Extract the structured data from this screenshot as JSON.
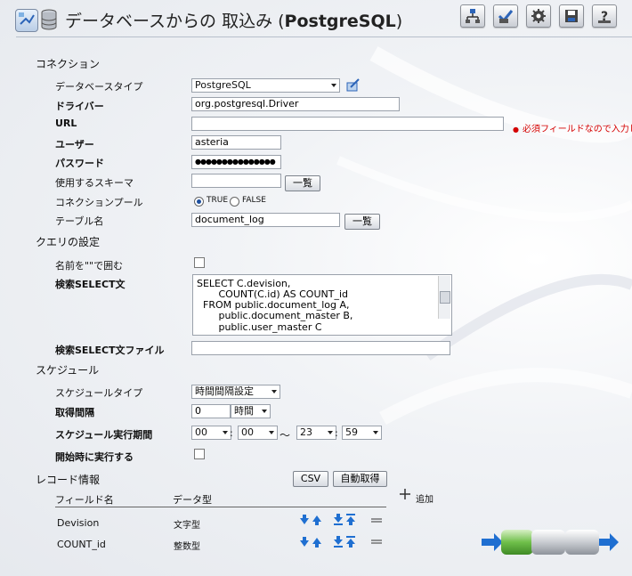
{
  "header": {
    "title_prefix": "データベースからの 取込み (",
    "title_db": "PostgreSQL",
    "title_suffix": ")",
    "toolbar": [
      "network-icon",
      "check-icon",
      "gear-icon",
      "save-icon",
      "help-icon"
    ]
  },
  "connection": {
    "heading": "コネクション",
    "db_type_label": "データベースタイプ",
    "db_type_value": "PostgreSQL",
    "driver_label": "ドライバー",
    "driver_value": "org.postgresql.Driver",
    "url_label": "URL",
    "url_value": "",
    "required_note": "必須フィールドなので入力して",
    "user_label": "ユーザー",
    "user_value": "asteria",
    "password_label": "パスワード",
    "password_value": "●●●●●●●●●●●●●●●",
    "schema_label": "使用するスキーマ",
    "schema_value": "",
    "list_button": "一覧",
    "pool_label": "コネクションプール",
    "pool_true": "TRUE",
    "pool_false": "FALSE",
    "pool_selected": "TRUE",
    "table_label": "テーブル名",
    "table_value": "document_log",
    "table_list_button": "一覧"
  },
  "query": {
    "heading": "クエリの設定",
    "quote_label": "名前を\"\"で囲む",
    "quote_checked": false,
    "select_label": "検索SELECT文",
    "select_lines": [
      "SELECT C.devision,",
      "       COUNT(C.id) AS COUNT_id",
      "  FROM public.document_log A,",
      "       public.document_master B,",
      "       public.user_master C"
    ],
    "select_file_label": "検索SELECT文ファイル",
    "select_file_value": ""
  },
  "schedule": {
    "heading": "スケジュール",
    "type_label": "スケジュールタイプ",
    "type_value": "時間間隔設定",
    "interval_label": "取得間隔",
    "interval_value": "0",
    "interval_unit": "時間",
    "period_label": "スケジュール実行期間",
    "start_hour": "00",
    "start_min": "00",
    "sep_colon": ":",
    "sep_tilde": "～",
    "end_hour": "23",
    "end_min": "59",
    "run_on_start_label": "開始時に実行する",
    "run_on_start_checked": false
  },
  "record": {
    "heading": "レコード情報",
    "csv_button": "CSV",
    "auto_button": "自動取得",
    "add_label": "追加",
    "col_field": "フィールド名",
    "col_type": "データ型",
    "rows": [
      {
        "name": "Devision",
        "type": "文字型"
      },
      {
        "name": "COUNT_id",
        "type": "整数型"
      }
    ]
  },
  "colors": {
    "accent_blue": "#1f6fd1",
    "required_red": "#d40000",
    "pipe_green": "#6fbf4a"
  }
}
